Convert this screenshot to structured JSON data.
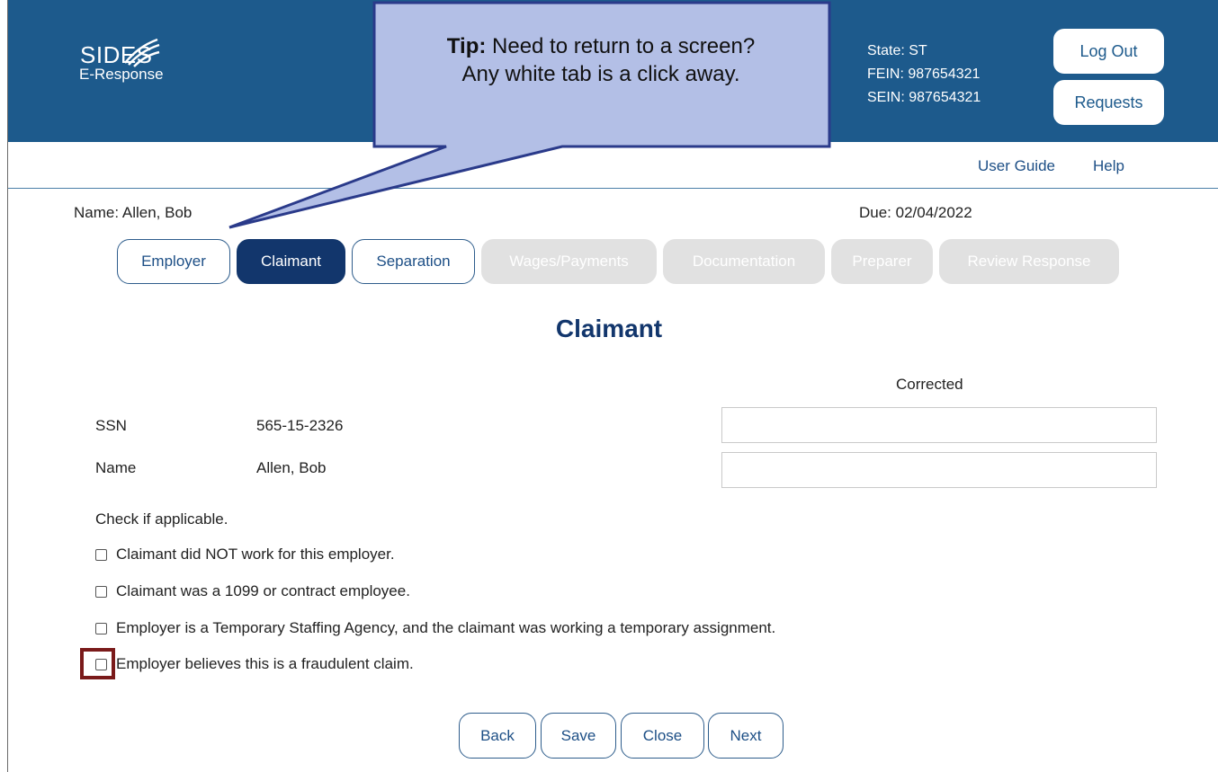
{
  "header": {
    "logo_main": "SIDES",
    "logo_sub": "E-Response",
    "state": "State: ST",
    "fein": "FEIN: 987654321",
    "sein": "SEIN: 987654321",
    "logout_label": "Log Out",
    "requests_label": "Requests"
  },
  "topnav": {
    "user_guide": "User Guide",
    "help": "Help"
  },
  "info": {
    "name": "Name:  Allen, Bob",
    "due": "Due:  02/04/2022"
  },
  "tabs": [
    {
      "label": "Employer",
      "state": "open"
    },
    {
      "label": "Claimant",
      "state": "active"
    },
    {
      "label": "Separation",
      "state": "open"
    },
    {
      "label": "Wages/Payments",
      "state": "disabled"
    },
    {
      "label": "Documentation",
      "state": "disabled"
    },
    {
      "label": "Preparer",
      "state": "disabled"
    },
    {
      "label": "Review Response",
      "state": "disabled"
    }
  ],
  "page_title": "Claimant",
  "form": {
    "corrected_header": "Corrected",
    "rows": [
      {
        "label": "SSN",
        "value": "565-15-2326",
        "corrected": ""
      },
      {
        "label": "Name",
        "value": "Allen, Bob",
        "corrected": ""
      }
    ],
    "check_intro": "Check if applicable.",
    "checks": [
      {
        "label": "Claimant did NOT work for this employer.",
        "checked": false
      },
      {
        "label": "Claimant was a 1099 or contract employee.",
        "checked": false
      },
      {
        "label": "Employer is a Temporary Staffing Agency, and the claimant was working a temporary assignment.",
        "checked": false
      },
      {
        "label": "Employer believes this is a fraudulent claim.",
        "checked": false
      }
    ]
  },
  "buttons": {
    "back": "Back",
    "save": "Save",
    "close": "Close",
    "next": "Next"
  },
  "tip": {
    "bold": "Tip:",
    "line1": " Need to return to a screen?",
    "line2": "Any white tab is a click away."
  },
  "colors": {
    "header_bg": "#1d5a8c",
    "active_tab": "#12366c",
    "tip_fill": "#b3bfe6",
    "tip_border": "#2a3a8a",
    "highlight": "#7a1a1a"
  }
}
